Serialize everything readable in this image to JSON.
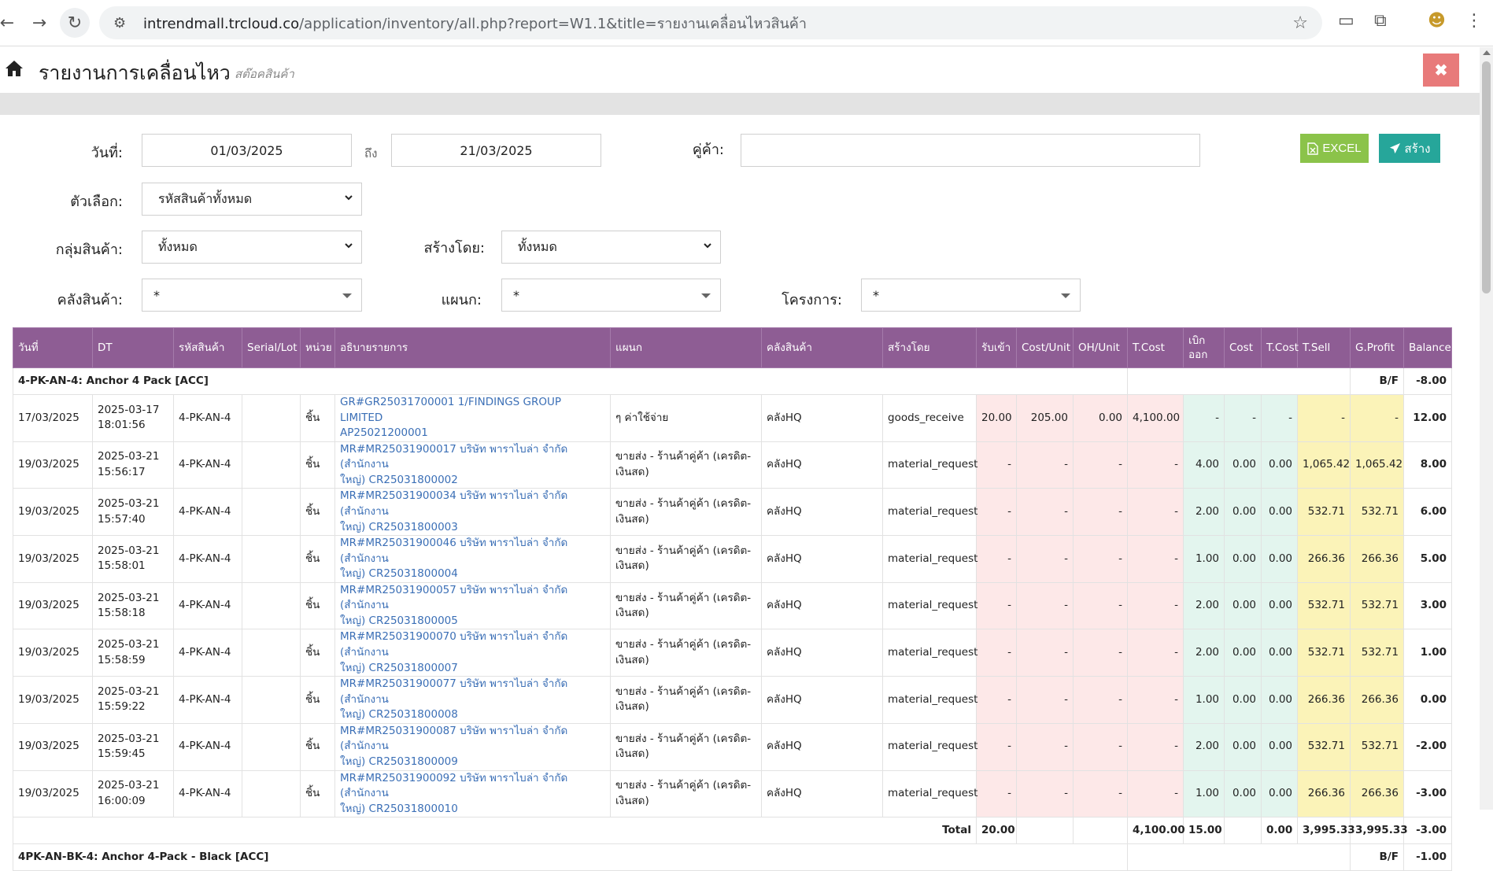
{
  "browser": {
    "url_host": "intrendmall.trcloud.co",
    "url_path": "/application/inventory/all.php?report=W1.1&title=รายงานเคลื่อนไหวสินค้า"
  },
  "header": {
    "title": "รายงานการเคลื่อนไหว",
    "subtitle": "สต๊อคสินค้า",
    "close_label": "✖"
  },
  "form": {
    "date_label": "วันที่:",
    "date_from": "01/03/2025",
    "to_label": "ถึง",
    "date_to": "21/03/2025",
    "partner_label": "คู่ค้า:",
    "partner_value": "",
    "option_label": "ตัวเลือก:",
    "option_value": "รหัสสินค้าทั้งหมด",
    "group_label": "กลุ่มสินค้า:",
    "group_value": "ทั้งหมด",
    "created_by_label": "สร้างโดย:",
    "created_by_value": "ทั้งหมด",
    "warehouse_label": "คลังสินค้า:",
    "warehouse_value": "*",
    "department_label": "แผนก:",
    "department_value": "*",
    "project_label": "โครงการ:",
    "project_value": "*",
    "excel_label": "EXCEL",
    "create_label": "สร้าง"
  },
  "table": {
    "columns": [
      "วันที่",
      "DT",
      "รหัสสินค้า",
      "Serial/Lot",
      "หน่วย",
      "อธิบายรายการ",
      "แผนก",
      "คลังสินค้า",
      "สร้างโดย",
      "รับเข้า",
      "Cost/Unit",
      "OH/Unit",
      "T.Cost",
      "เบิก ออก",
      "Cost",
      "T.Cost",
      "T.Sell",
      "G.Profit",
      "Balance"
    ],
    "group1": {
      "name": "4-PK-AN-4: Anchor 4 Pack [ACC]",
      "bf_label": "B/F",
      "bf_value": "-8.00"
    },
    "rows": [
      {
        "date": "17/03/2025",
        "dt1": "2025-03-17",
        "dt2": "18:01:56",
        "code": "4-PK-AN-4",
        "serial": "",
        "unit": "ชิ้น",
        "desc1": "GR#GR25031700001 1/FINDINGS GROUP LIMITED",
        "desc2": "AP25021200001",
        "dept1": "ๆ ค่าใช้จ่าย",
        "dept2": "",
        "wh": "คลังHQ",
        "by": "goods_receive",
        "recv": "20.00",
        "cpu": "205.00",
        "ohu": "0.00",
        "tcost": "4,100.00",
        "iss": "-",
        "cost": "-",
        "tcost2": "-",
        "tsell": "-",
        "gp": "-",
        "bal": "12.00"
      },
      {
        "date": "19/03/2025",
        "dt1": "2025-03-21",
        "dt2": "15:56:17",
        "code": "4-PK-AN-4",
        "serial": "",
        "unit": "ชิ้น",
        "desc1": "MR#MR25031900017 บริษัท พาราไบล่า จำกัด (สำนักงาน",
        "desc2": "ใหญ่) CR25031800002",
        "dept1": "ขายส่ง - ร้านค้าคู่ค้า (เครดิต-",
        "dept2": "เงินสด)",
        "wh": "คลังHQ",
        "by": "material_request",
        "recv": "-",
        "cpu": "-",
        "ohu": "-",
        "tcost": "-",
        "iss": "4.00",
        "cost": "0.00",
        "tcost2": "0.00",
        "tsell": "1,065.42",
        "gp": "1,065.42",
        "bal": "8.00"
      },
      {
        "date": "19/03/2025",
        "dt1": "2025-03-21",
        "dt2": "15:57:40",
        "code": "4-PK-AN-4",
        "serial": "",
        "unit": "ชิ้น",
        "desc1": "MR#MR25031900034 บริษัท พาราไบล่า จำกัด (สำนักงาน",
        "desc2": "ใหญ่) CR25031800003",
        "dept1": "ขายส่ง - ร้านค้าคู่ค้า (เครดิต-",
        "dept2": "เงินสด)",
        "wh": "คลังHQ",
        "by": "material_request",
        "recv": "-",
        "cpu": "-",
        "ohu": "-",
        "tcost": "-",
        "iss": "2.00",
        "cost": "0.00",
        "tcost2": "0.00",
        "tsell": "532.71",
        "gp": "532.71",
        "bal": "6.00"
      },
      {
        "date": "19/03/2025",
        "dt1": "2025-03-21",
        "dt2": "15:58:01",
        "code": "4-PK-AN-4",
        "serial": "",
        "unit": "ชิ้น",
        "desc1": "MR#MR25031900046 บริษัท พาราไบล่า จำกัด (สำนักงาน",
        "desc2": "ใหญ่) CR25031800004",
        "dept1": "ขายส่ง - ร้านค้าคู่ค้า (เครดิต-",
        "dept2": "เงินสด)",
        "wh": "คลังHQ",
        "by": "material_request",
        "recv": "-",
        "cpu": "-",
        "ohu": "-",
        "tcost": "-",
        "iss": "1.00",
        "cost": "0.00",
        "tcost2": "0.00",
        "tsell": "266.36",
        "gp": "266.36",
        "bal": "5.00"
      },
      {
        "date": "19/03/2025",
        "dt1": "2025-03-21",
        "dt2": "15:58:18",
        "code": "4-PK-AN-4",
        "serial": "",
        "unit": "ชิ้น",
        "desc1": "MR#MR25031900057 บริษัท พาราไบล่า จำกัด (สำนักงาน",
        "desc2": "ใหญ่) CR25031800005",
        "dept1": "ขายส่ง - ร้านค้าคู่ค้า (เครดิต-",
        "dept2": "เงินสด)",
        "wh": "คลังHQ",
        "by": "material_request",
        "recv": "-",
        "cpu": "-",
        "ohu": "-",
        "tcost": "-",
        "iss": "2.00",
        "cost": "0.00",
        "tcost2": "0.00",
        "tsell": "532.71",
        "gp": "532.71",
        "bal": "3.00"
      },
      {
        "date": "19/03/2025",
        "dt1": "2025-03-21",
        "dt2": "15:58:59",
        "code": "4-PK-AN-4",
        "serial": "",
        "unit": "ชิ้น",
        "desc1": "MR#MR25031900070 บริษัท พาราไบล่า จำกัด (สำนักงาน",
        "desc2": "ใหญ่) CR25031800007",
        "dept1": "ขายส่ง - ร้านค้าคู่ค้า (เครดิต-",
        "dept2": "เงินสด)",
        "wh": "คลังHQ",
        "by": "material_request",
        "recv": "-",
        "cpu": "-",
        "ohu": "-",
        "tcost": "-",
        "iss": "2.00",
        "cost": "0.00",
        "tcost2": "0.00",
        "tsell": "532.71",
        "gp": "532.71",
        "bal": "1.00"
      },
      {
        "date": "19/03/2025",
        "dt1": "2025-03-21",
        "dt2": "15:59:22",
        "code": "4-PK-AN-4",
        "serial": "",
        "unit": "ชิ้น",
        "desc1": "MR#MR25031900077 บริษัท พาราไบล่า จำกัด (สำนักงาน",
        "desc2": "ใหญ่) CR25031800008",
        "dept1": "ขายส่ง - ร้านค้าคู่ค้า (เครดิต-",
        "dept2": "เงินสด)",
        "wh": "คลังHQ",
        "by": "material_request",
        "recv": "-",
        "cpu": "-",
        "ohu": "-",
        "tcost": "-",
        "iss": "1.00",
        "cost": "0.00",
        "tcost2": "0.00",
        "tsell": "266.36",
        "gp": "266.36",
        "bal": "0.00"
      },
      {
        "date": "19/03/2025",
        "dt1": "2025-03-21",
        "dt2": "15:59:45",
        "code": "4-PK-AN-4",
        "serial": "",
        "unit": "ชิ้น",
        "desc1": "MR#MR25031900087 บริษัท พาราไบล่า จำกัด (สำนักงาน",
        "desc2": "ใหญ่) CR25031800009",
        "dept1": "ขายส่ง - ร้านค้าคู่ค้า (เครดิต-",
        "dept2": "เงินสด)",
        "wh": "คลังHQ",
        "by": "material_request",
        "recv": "-",
        "cpu": "-",
        "ohu": "-",
        "tcost": "-",
        "iss": "2.00",
        "cost": "0.00",
        "tcost2": "0.00",
        "tsell": "532.71",
        "gp": "532.71",
        "bal": "-2.00"
      },
      {
        "date": "19/03/2025",
        "dt1": "2025-03-21",
        "dt2": "16:00:09",
        "code": "4-PK-AN-4",
        "serial": "",
        "unit": "ชิ้น",
        "desc1": "MR#MR25031900092 บริษัท พาราไบล่า จำกัด (สำนักงาน",
        "desc2": "ใหญ่) CR25031800010",
        "dept1": "ขายส่ง - ร้านค้าคู่ค้า (เครดิต-",
        "dept2": "เงินสด)",
        "wh": "คลังHQ",
        "by": "material_request",
        "recv": "-",
        "cpu": "-",
        "ohu": "-",
        "tcost": "-",
        "iss": "1.00",
        "cost": "0.00",
        "tcost2": "0.00",
        "tsell": "266.36",
        "gp": "266.36",
        "bal": "-3.00"
      }
    ],
    "total": {
      "label": "Total",
      "recv": "20.00",
      "tcost": "4,100.00",
      "iss": "15.00",
      "tcost2": "0.00",
      "tsell": "3,995.33",
      "gp": "3,995.33",
      "bal": "-3.00"
    },
    "group2": {
      "name": "4PK-AN-BK-4: Anchor 4-Pack - Black [ACC]",
      "bf_label": "B/F",
      "bf_value": "-1.00"
    }
  }
}
